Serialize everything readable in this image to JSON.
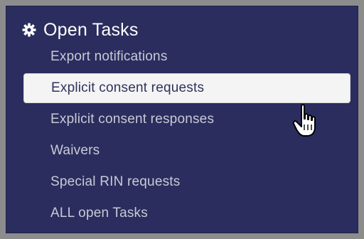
{
  "panel": {
    "title": "Open Tasks",
    "title_icon": "gear-icon",
    "items": [
      {
        "label": "Export notifications"
      },
      {
        "label": "Explicit consent requests",
        "active": true
      },
      {
        "label": "Explicit consent responses"
      },
      {
        "label": "Waivers"
      },
      {
        "label": "Special RIN requests"
      },
      {
        "label": "ALL open Tasks"
      }
    ]
  },
  "colors": {
    "panel_bg": "#2b2d5e",
    "item_text": "#c9cad6",
    "active_bg": "#f4f4f4",
    "active_text": "#30325e"
  },
  "cursor": "hand-pointer-icon"
}
